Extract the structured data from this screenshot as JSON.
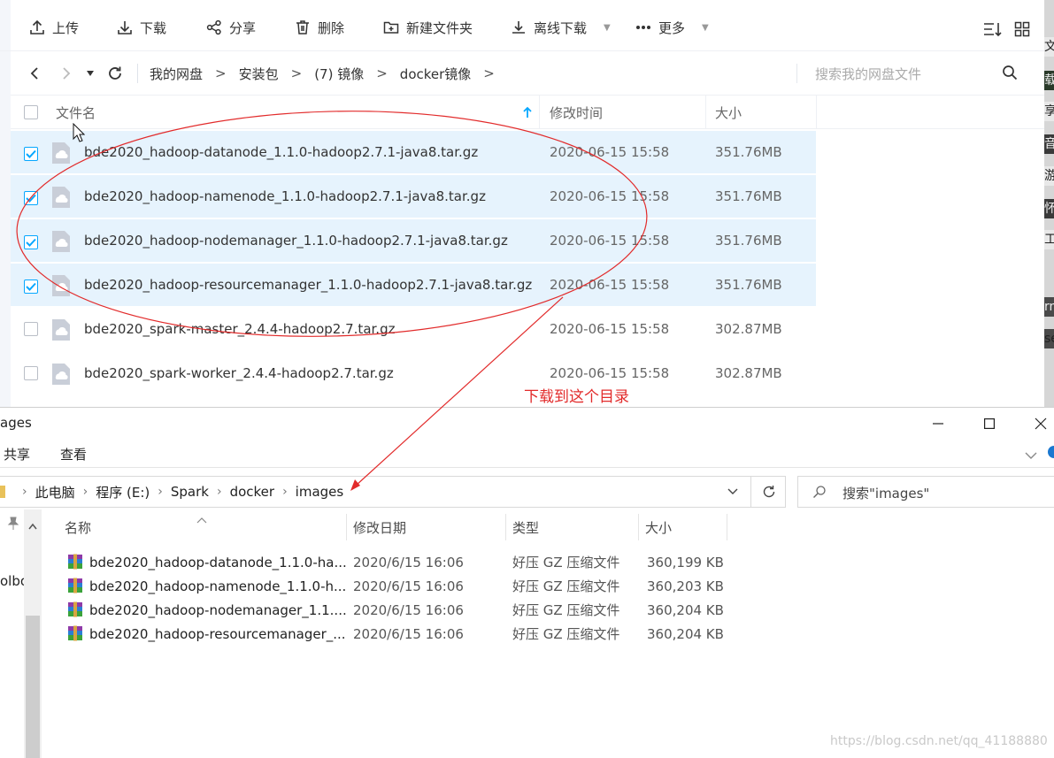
{
  "pan": {
    "toolbar": {
      "upload": "上传",
      "download": "下载",
      "share": "分享",
      "delete": "删除",
      "new_folder": "新建文件夹",
      "offline_download": "离线下载",
      "more": "更多"
    },
    "breadcrumb": [
      "我的网盘",
      "安装包",
      "(7) 镜像",
      "docker镜像"
    ],
    "search_placeholder": "搜索我的网盘文件",
    "columns": {
      "name": "文件名",
      "modified": "修改时间",
      "size": "大小"
    },
    "files": [
      {
        "name": "bde2020_hadoop-datanode_1.1.0-hadoop2.7.1-java8.tar.gz",
        "modified": "2020-06-15 15:58",
        "size": "351.76MB",
        "checked": true
      },
      {
        "name": "bde2020_hadoop-namenode_1.1.0-hadoop2.7.1-java8.tar.gz",
        "modified": "2020-06-15 15:58",
        "size": "351.76MB",
        "checked": true
      },
      {
        "name": "bde2020_hadoop-nodemanager_1.1.0-hadoop2.7.1-java8.tar.gz",
        "modified": "2020-06-15 15:58",
        "size": "351.76MB",
        "checked": true
      },
      {
        "name": "bde2020_hadoop-resourcemanager_1.1.0-hadoop2.7.1-java8.tar.gz",
        "modified": "2020-06-15 15:58",
        "size": "351.76MB",
        "checked": true
      },
      {
        "name": "bde2020_spark-master_2.4.4-hadoop2.7.tar.gz",
        "modified": "2020-06-15 15:58",
        "size": "302.87MB",
        "checked": false
      },
      {
        "name": "bde2020_spark-worker_2.4.4-hadoop2.7.tar.gz",
        "modified": "2020-06-15 15:58",
        "size": "302.87MB",
        "checked": false
      }
    ],
    "right_strip_chars": [
      "文",
      "载",
      "享",
      "音",
      "游",
      "怀",
      "工",
      "rn",
      "se"
    ]
  },
  "annotation": {
    "text": "下载到这个目录",
    "color": "#e22b2b"
  },
  "explorer": {
    "title": "ages",
    "ribbon": {
      "share": "共享",
      "view": "查看"
    },
    "address": [
      "此电脑",
      "程序 (E:)",
      "Spark",
      "docker",
      "images"
    ],
    "search_placeholder": "搜索\"images\"",
    "nav_pane_text": "olbo",
    "columns": {
      "name": "名称",
      "modified": "修改日期",
      "type": "类型",
      "size": "大小"
    },
    "files": [
      {
        "name": "bde2020_hadoop-datanode_1.1.0-ha...",
        "modified": "2020/6/15 16:06",
        "type": "好压 GZ 压缩文件",
        "size": "360,199 KB"
      },
      {
        "name": "bde2020_hadoop-namenode_1.1.0-h...",
        "modified": "2020/6/15 16:06",
        "type": "好压 GZ 压缩文件",
        "size": "360,203 KB"
      },
      {
        "name": "bde2020_hadoop-nodemanager_1.1....",
        "modified": "2020/6/15 16:06",
        "type": "好压 GZ 压缩文件",
        "size": "360,204 KB"
      },
      {
        "name": "bde2020_hadoop-resourcemanager_...",
        "modified": "2020/6/15 16:06",
        "type": "好压 GZ 压缩文件",
        "size": "360,204 KB"
      }
    ]
  },
  "watermark": "https://blog.csdn.net/qq_41188880",
  "colors": {
    "accent": "#06a7ff",
    "selected_row": "#e6f3fd",
    "annotation": "#e22b2b"
  }
}
